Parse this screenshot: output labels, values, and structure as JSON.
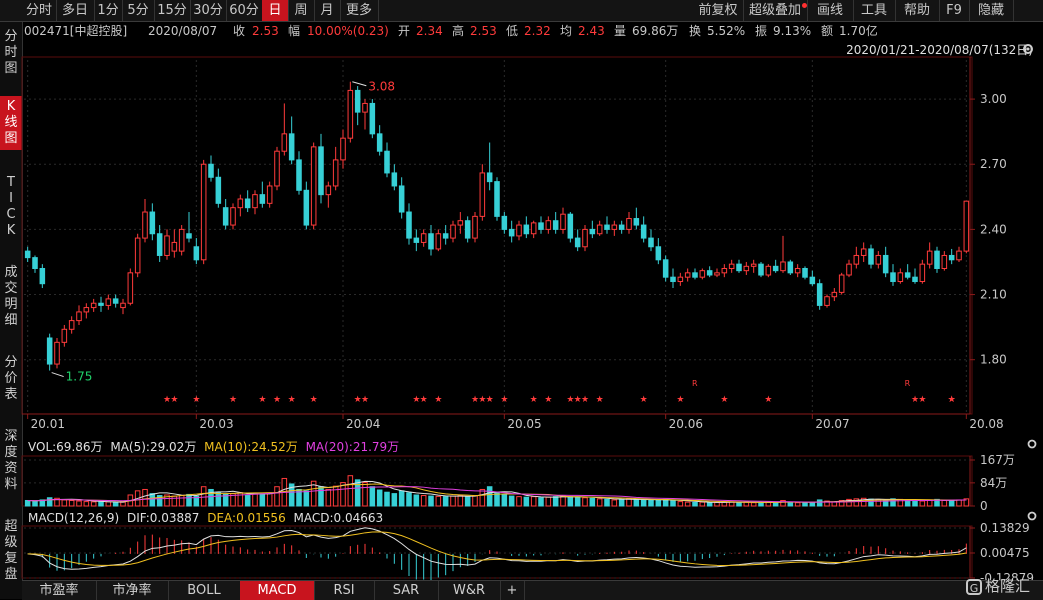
{
  "toolbar": {
    "tabs": [
      {
        "label": "分时",
        "active": false
      },
      {
        "label": "多日",
        "active": false
      },
      {
        "label": "1分",
        "active": false
      },
      {
        "label": "5分",
        "active": false
      },
      {
        "label": "15分",
        "active": false
      },
      {
        "label": "30分",
        "active": false
      },
      {
        "label": "60分",
        "active": false
      },
      {
        "label": "日",
        "active": true
      },
      {
        "label": "周",
        "active": false
      },
      {
        "label": "月",
        "active": false
      },
      {
        "label": "更多",
        "active": false
      }
    ],
    "right_tools": [
      "前复权",
      "超级叠加",
      "画线",
      "工具",
      "帮助",
      "F9",
      "隐藏"
    ]
  },
  "stock_info": {
    "code_name": "002471[中超控股]",
    "date": "2020/08/07",
    "close_label": "收",
    "close": "2.53",
    "amp_label": "幅",
    "amp": "10.00%(0.23)",
    "open_label": "开",
    "open": "2.34",
    "high_label": "高",
    "high": "2.53",
    "low_label": "低",
    "low": "2.32",
    "avg_label": "均",
    "avg": "2.43",
    "vol_label": "量",
    "vol": "69.86万",
    "turnover_label": "换",
    "turnover": "5.52%",
    "swing_label": "振",
    "swing": "9.13%",
    "amount_label": "额",
    "amount": "1.70亿"
  },
  "date_range": "2020/01/21-2020/08/07(132日)",
  "left_tabs": [
    {
      "label": "分时图",
      "active": false
    },
    {
      "label": "K线图",
      "active": true
    },
    {
      "label": "TICK",
      "active": false
    },
    {
      "label": "成交明细",
      "active": false
    },
    {
      "label": "分价表",
      "active": false
    },
    {
      "label": "深度资料",
      "active": false
    },
    {
      "label": "超级复盘",
      "active": false
    }
  ],
  "bottom_tabs": [
    {
      "label": "市盈率",
      "active": false
    },
    {
      "label": "市净率",
      "active": false
    },
    {
      "label": "BOLL",
      "active": false
    },
    {
      "label": "MACD",
      "active": true
    },
    {
      "label": "RSI",
      "active": false
    },
    {
      "label": "SAR",
      "active": false
    },
    {
      "label": "W&R",
      "active": false
    },
    {
      "label": "+",
      "active": false
    }
  ],
  "volume_legend": {
    "vol": "VOL:69.86万",
    "ma5": "MA(5):29.02万",
    "ma10": "MA(10):24.52万",
    "ma20": "MA(20):21.79万"
  },
  "macd_legend": {
    "title": "MACD(12,26,9)",
    "dif": "DIF:0.03887",
    "dea": "DEA:0.01556",
    "macd": "MACD:0.04663"
  },
  "watermark": "格隆汇",
  "colors": {
    "up": "#ff3b3b",
    "down": "#37d0d6",
    "ma5": "#e0e0e0",
    "ma10": "#f0c020",
    "ma20": "#e040e0",
    "active": "#c8141e"
  },
  "chart_data": [
    {
      "type": "candlestick",
      "x_labels": [
        "20.01",
        "20.03",
        "20.04",
        "20.05",
        "20.06",
        "20.07",
        "20.08"
      ],
      "y_ticks": [
        "3.00",
        "2.70",
        "2.40",
        "2.10",
        "1.80"
      ],
      "ylim": [
        1.55,
        3.18
      ],
      "high_annotation": "3.08",
      "low_annotation": "1.75",
      "star_marker": "★",
      "r_marker": "R",
      "series": [
        {
          "name": "K",
          "ohlc": [
            [
              2.3,
              2.32,
              2.25,
              2.27
            ],
            [
              2.27,
              2.28,
              2.2,
              2.22
            ],
            [
              2.22,
              2.24,
              2.13,
              2.15
            ],
            [
              1.9,
              1.92,
              1.75,
              1.78
            ],
            [
              1.78,
              1.9,
              1.76,
              1.88
            ],
            [
              1.88,
              1.96,
              1.86,
              1.94
            ],
            [
              1.94,
              2.0,
              1.92,
              1.98
            ],
            [
              1.98,
              2.05,
              1.96,
              2.02
            ],
            [
              2.02,
              2.06,
              1.99,
              2.04
            ],
            [
              2.04,
              2.08,
              2.02,
              2.06
            ],
            [
              2.06,
              2.09,
              2.02,
              2.05
            ],
            [
              2.05,
              2.1,
              2.03,
              2.08
            ],
            [
              2.08,
              2.1,
              2.04,
              2.06
            ],
            [
              2.04,
              2.08,
              2.01,
              2.06
            ],
            [
              2.06,
              2.22,
              2.05,
              2.2
            ],
            [
              2.2,
              2.38,
              2.18,
              2.36
            ],
            [
              2.36,
              2.54,
              2.34,
              2.48
            ],
            [
              2.48,
              2.52,
              2.35,
              2.38
            ],
            [
              2.38,
              2.42,
              2.25,
              2.28
            ],
            [
              2.28,
              2.4,
              2.26,
              2.37
            ],
            [
              2.3,
              2.4,
              2.27,
              2.34
            ],
            [
              2.3,
              2.42,
              2.28,
              2.4
            ],
            [
              2.38,
              2.48,
              2.34,
              2.36
            ],
            [
              2.32,
              2.36,
              2.24,
              2.26
            ],
            [
              2.26,
              2.72,
              2.24,
              2.7
            ],
            [
              2.7,
              2.74,
              2.62,
              2.64
            ],
            [
              2.64,
              2.68,
              2.5,
              2.52
            ],
            [
              2.5,
              2.54,
              2.4,
              2.42
            ],
            [
              2.42,
              2.52,
              2.4,
              2.5
            ],
            [
              2.5,
              2.56,
              2.46,
              2.54
            ],
            [
              2.54,
              2.58,
              2.48,
              2.5
            ],
            [
              2.5,
              2.58,
              2.47,
              2.56
            ],
            [
              2.56,
              2.62,
              2.5,
              2.52
            ],
            [
              2.52,
              2.62,
              2.5,
              2.6
            ],
            [
              2.6,
              2.78,
              2.58,
              2.76
            ],
            [
              2.76,
              2.98,
              2.74,
              2.84
            ],
            [
              2.84,
              2.92,
              2.7,
              2.72
            ],
            [
              2.72,
              2.76,
              2.56,
              2.58
            ],
            [
              2.58,
              2.62,
              2.4,
              2.42
            ],
            [
              2.42,
              2.8,
              2.4,
              2.78
            ],
            [
              2.78,
              2.84,
              2.52,
              2.56
            ],
            [
              2.56,
              2.62,
              2.5,
              2.6
            ],
            [
              2.6,
              2.78,
              2.58,
              2.72
            ],
            [
              2.72,
              2.86,
              2.68,
              2.82
            ],
            [
              2.82,
              3.08,
              2.8,
              3.04
            ],
            [
              3.04,
              3.06,
              2.88,
              2.94
            ],
            [
              2.94,
              3.0,
              2.86,
              2.98
            ],
            [
              2.98,
              3.0,
              2.82,
              2.84
            ],
            [
              2.84,
              2.88,
              2.74,
              2.76
            ],
            [
              2.76,
              2.8,
              2.64,
              2.66
            ],
            [
              2.66,
              2.7,
              2.58,
              2.6
            ],
            [
              2.6,
              2.64,
              2.45,
              2.48
            ],
            [
              2.48,
              2.52,
              2.33,
              2.36
            ],
            [
              2.36,
              2.4,
              2.3,
              2.34
            ],
            [
              2.34,
              2.4,
              2.32,
              2.38
            ],
            [
              2.38,
              2.42,
              2.28,
              2.31
            ],
            [
              2.31,
              2.4,
              2.3,
              2.38
            ],
            [
              2.38,
              2.42,
              2.33,
              2.36
            ],
            [
              2.36,
              2.44,
              2.34,
              2.42
            ],
            [
              2.42,
              2.48,
              2.38,
              2.44
            ],
            [
              2.44,
              2.46,
              2.34,
              2.36
            ],
            [
              2.36,
              2.48,
              2.34,
              2.46
            ],
            [
              2.46,
              2.7,
              2.44,
              2.66
            ],
            [
              2.66,
              2.8,
              2.58,
              2.62
            ],
            [
              2.62,
              2.64,
              2.44,
              2.46
            ],
            [
              2.46,
              2.48,
              2.38,
              2.4
            ],
            [
              2.4,
              2.44,
              2.34,
              2.37
            ],
            [
              2.37,
              2.44,
              2.35,
              2.42
            ],
            [
              2.42,
              2.46,
              2.36,
              2.38
            ],
            [
              2.38,
              2.44,
              2.36,
              2.43
            ],
            [
              2.43,
              2.46,
              2.38,
              2.4
            ],
            [
              2.4,
              2.46,
              2.38,
              2.44
            ],
            [
              2.44,
              2.48,
              2.38,
              2.4
            ],
            [
              2.4,
              2.5,
              2.38,
              2.47
            ],
            [
              2.47,
              2.48,
              2.34,
              2.36
            ],
            [
              2.36,
              2.4,
              2.3,
              2.32
            ],
            [
              2.32,
              2.42,
              2.3,
              2.4
            ],
            [
              2.4,
              2.44,
              2.36,
              2.38
            ],
            [
              2.38,
              2.44,
              2.37,
              2.42
            ],
            [
              2.42,
              2.46,
              2.38,
              2.4
            ],
            [
              2.4,
              2.44,
              2.37,
              2.42
            ],
            [
              2.42,
              2.44,
              2.38,
              2.4
            ],
            [
              2.4,
              2.48,
              2.38,
              2.45
            ],
            [
              2.45,
              2.5,
              2.4,
              2.42
            ],
            [
              2.42,
              2.46,
              2.34,
              2.36
            ],
            [
              2.36,
              2.4,
              2.3,
              2.32
            ],
            [
              2.32,
              2.36,
              2.24,
              2.26
            ],
            [
              2.26,
              2.28,
              2.16,
              2.18
            ],
            [
              2.18,
              2.22,
              2.13,
              2.16
            ],
            [
              2.16,
              2.2,
              2.14,
              2.18
            ],
            [
              2.18,
              2.22,
              2.16,
              2.2
            ],
            [
              2.2,
              2.22,
              2.17,
              2.18
            ],
            [
              2.18,
              2.22,
              2.17,
              2.21
            ],
            [
              2.21,
              2.23,
              2.18,
              2.19
            ],
            [
              2.19,
              2.22,
              2.18,
              2.2
            ],
            [
              2.2,
              2.24,
              2.18,
              2.22
            ],
            [
              2.22,
              2.26,
              2.2,
              2.24
            ],
            [
              2.24,
              2.26,
              2.2,
              2.21
            ],
            [
              2.21,
              2.25,
              2.19,
              2.23
            ],
            [
              2.23,
              2.26,
              2.2,
              2.24
            ],
            [
              2.24,
              2.25,
              2.18,
              2.19
            ],
            [
              2.19,
              2.24,
              2.18,
              2.23
            ],
            [
              2.23,
              2.26,
              2.2,
              2.21
            ],
            [
              2.21,
              2.37,
              2.2,
              2.25
            ],
            [
              2.25,
              2.26,
              2.19,
              2.2
            ],
            [
              2.2,
              2.24,
              2.18,
              2.22
            ],
            [
              2.22,
              2.23,
              2.17,
              2.18
            ],
            [
              2.18,
              2.21,
              2.14,
              2.15
            ],
            [
              2.15,
              2.17,
              2.03,
              2.05
            ],
            [
              2.05,
              2.1,
              2.04,
              2.09
            ],
            [
              2.09,
              2.13,
              2.07,
              2.11
            ],
            [
              2.11,
              2.2,
              2.1,
              2.19
            ],
            [
              2.19,
              2.26,
              2.18,
              2.24
            ],
            [
              2.24,
              2.32,
              2.22,
              2.28
            ],
            [
              2.28,
              2.34,
              2.25,
              2.31
            ],
            [
              2.31,
              2.33,
              2.22,
              2.24
            ],
            [
              2.24,
              2.3,
              2.22,
              2.28
            ],
            [
              2.28,
              2.32,
              2.18,
              2.2
            ],
            [
              2.2,
              2.24,
              2.14,
              2.16
            ],
            [
              2.16,
              2.22,
              2.15,
              2.2
            ],
            [
              2.2,
              2.24,
              2.17,
              2.18
            ],
            [
              2.18,
              2.22,
              2.15,
              2.16
            ],
            [
              2.16,
              2.26,
              2.15,
              2.24
            ],
            [
              2.24,
              2.34,
              2.22,
              2.3
            ],
            [
              2.3,
              2.32,
              2.2,
              2.22
            ],
            [
              2.22,
              2.3,
              2.21,
              2.28
            ],
            [
              2.28,
              2.31,
              2.24,
              2.26
            ],
            [
              2.26,
              2.32,
              2.25,
              2.3
            ],
            [
              2.3,
              2.53,
              2.29,
              2.53
            ]
          ]
        }
      ]
    },
    {
      "type": "bar",
      "name": "volume",
      "y_ticks": [
        "167万",
        "84万",
        "0"
      ],
      "ylim": [
        0,
        167
      ],
      "values": [
        20,
        18,
        22,
        30,
        28,
        22,
        20,
        18,
        16,
        15,
        14,
        15,
        13,
        14,
        40,
        55,
        60,
        45,
        38,
        40,
        36,
        38,
        42,
        35,
        70,
        60,
        50,
        42,
        45,
        48,
        40,
        44,
        42,
        46,
        70,
        100,
        80,
        60,
        55,
        90,
        70,
        60,
        72,
        85,
        110,
        95,
        85,
        70,
        58,
        50,
        45,
        55,
        48,
        40,
        38,
        36,
        35,
        34,
        36,
        38,
        34,
        38,
        60,
        70,
        50,
        40,
        36,
        34,
        32,
        34,
        30,
        32,
        34,
        36,
        34,
        32,
        30,
        28,
        26,
        24,
        22,
        24,
        26,
        24,
        22,
        20,
        22,
        24,
        20,
        16,
        14,
        13,
        14,
        12,
        13,
        14,
        15,
        13,
        14,
        12,
        13,
        14,
        12,
        20,
        14,
        12,
        13,
        12,
        22,
        18,
        15,
        20,
        24,
        26,
        28,
        25,
        22,
        20,
        26,
        24,
        22,
        20,
        18,
        22,
        24,
        20,
        18,
        22,
        26,
        24,
        40,
        70
      ],
      "up_down": "follows candle color"
    },
    {
      "type": "bar",
      "name": "MACD",
      "y_ticks": [
        "0.13829",
        "0.00475",
        "-0.12879"
      ],
      "ylim": [
        -0.12879,
        0.13829
      ]
    }
  ]
}
